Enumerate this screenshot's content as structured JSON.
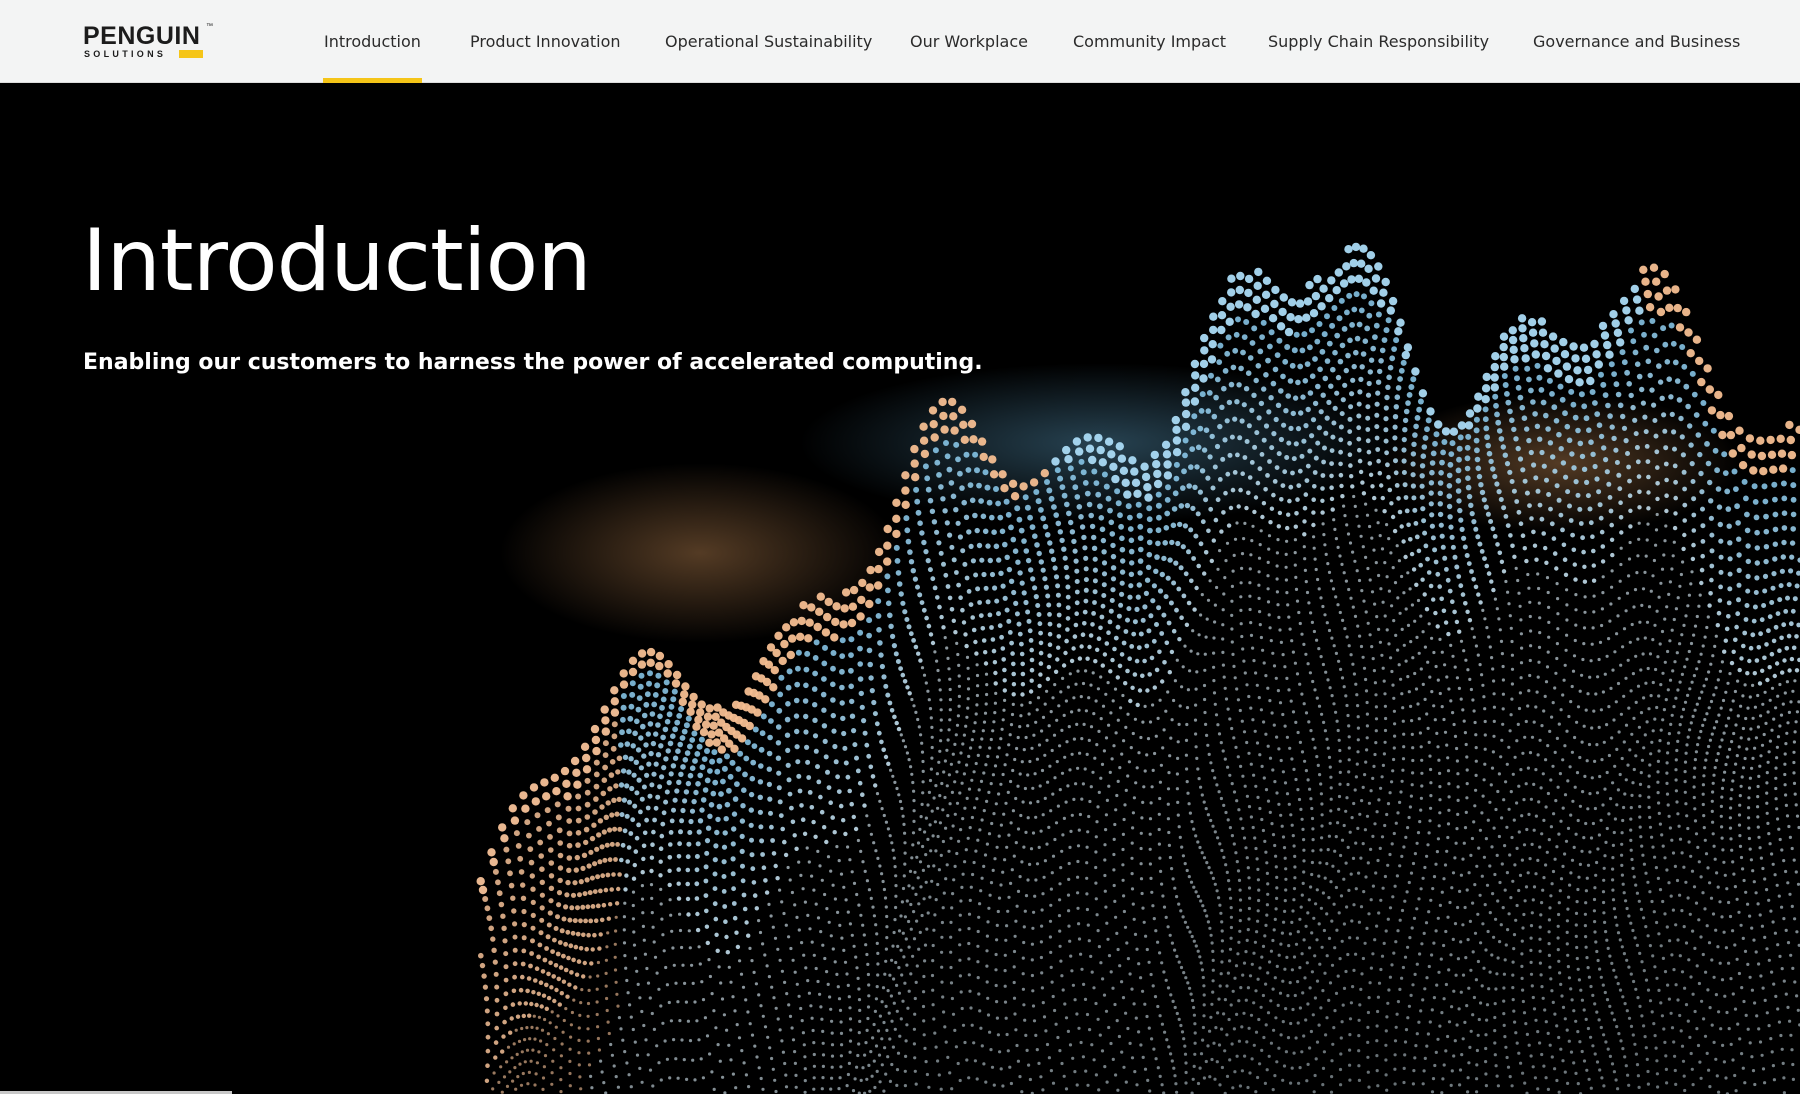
{
  "brand": {
    "name": "PENGUIN",
    "sub": "SOLUTIONS",
    "trademark": "™",
    "accent_color": "#f5c518"
  },
  "nav": {
    "items": [
      {
        "label": "Introduction",
        "active": true
      },
      {
        "label": "Product Innovation",
        "active": false
      },
      {
        "label": "Operational Sustainability",
        "active": false
      },
      {
        "label": "Our Workplace",
        "active": false
      },
      {
        "label": "Community Impact",
        "active": false
      },
      {
        "label": "Supply Chain Responsibility",
        "active": false
      },
      {
        "label": "Governance and Business",
        "active": false
      }
    ]
  },
  "hero": {
    "title": "Introduction",
    "subtitle": "Enabling our customers to harness the power of accelerated computing.",
    "background_color": "#000000",
    "art_colors": {
      "blue": "#7cc6ee",
      "orange": "#f2b27e",
      "white": "#ffffff"
    }
  }
}
